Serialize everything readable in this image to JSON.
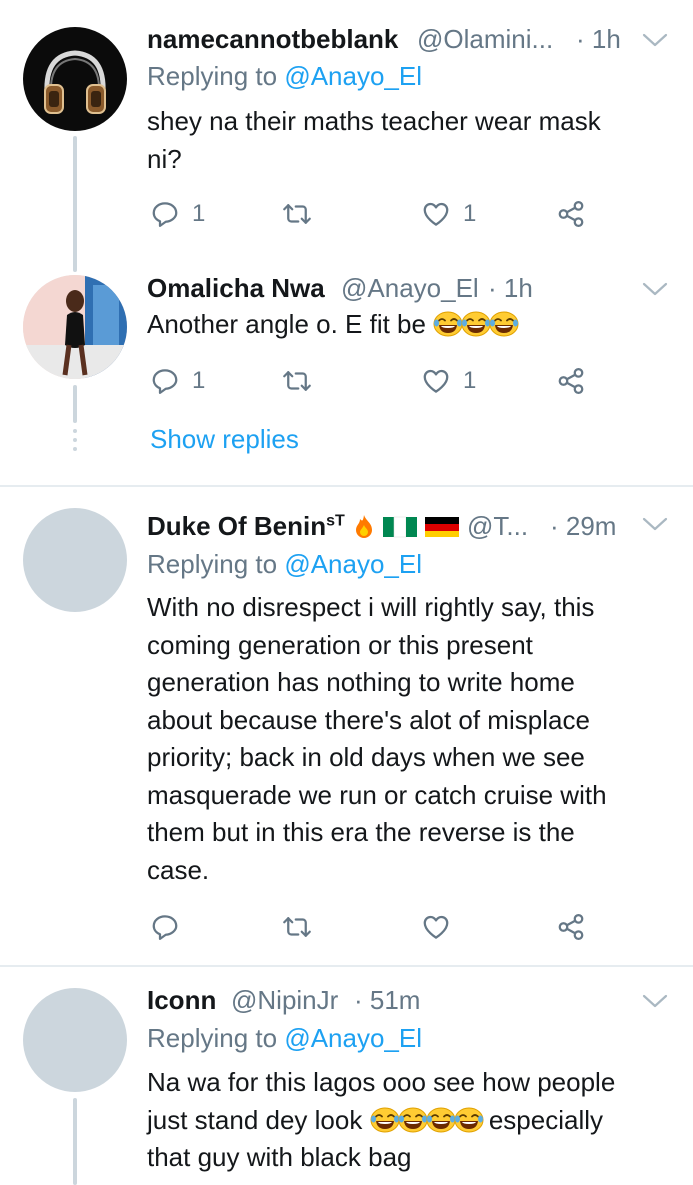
{
  "tweets": [
    {
      "name": "namecannotbeblank",
      "handle": "@Olamini...",
      "time": "· 1h",
      "replying_prefix": "Replying to ",
      "replying_handle": "@Anayo_El",
      "text_lines": [
        "shey na their maths teacher wear mask",
        "ni?"
      ],
      "reply_count": "1",
      "retweet_count": "",
      "like_count": "1",
      "avatar_icon": "headphones-icon"
    },
    {
      "name": "Omalicha Nwa",
      "handle": "@Anayo_El",
      "time": "· 1h",
      "text": "Another angle o. E fit be",
      "emoji_count": 3,
      "reply_count": "1",
      "like_count": "1",
      "show_replies": "Show replies"
    },
    {
      "name": "Duke Of Benin",
      "name_suffix": "sT",
      "handle": "@T...",
      "time": "· 29m",
      "replying_prefix": "Replying to ",
      "replying_handle": "@Anayo_El",
      "text_lines": [
        "With no disrespect i will rightly say, this",
        "coming generation or this present",
        "generation has nothing to write home",
        "about because there's alot of misplace",
        "priority; back in old days when we see",
        "masquerade we run or catch cruise with",
        "them but in this era the reverse is the",
        "case."
      ],
      "flags": [
        "fire-icon",
        "nigeria-flag-icon",
        "germany-flag-icon"
      ]
    },
    {
      "name": "Iconn",
      "handle": "@NipinJr",
      "time": "· 51m",
      "replying_prefix": "Replying to ",
      "replying_handle": "@Anayo_El",
      "text_line1": "Na wa for this lagos ooo see how people",
      "text_line2_before": "just stand dey look",
      "text_line2_after": "especially",
      "text_line3": "that guy with black bag",
      "emoji_count": 4
    }
  ],
  "colors": {
    "accent": "#1da1f2",
    "secondary_text": "#657786",
    "divider": "#e6ecf0",
    "avatar_placeholder": "#ccd6dd"
  }
}
